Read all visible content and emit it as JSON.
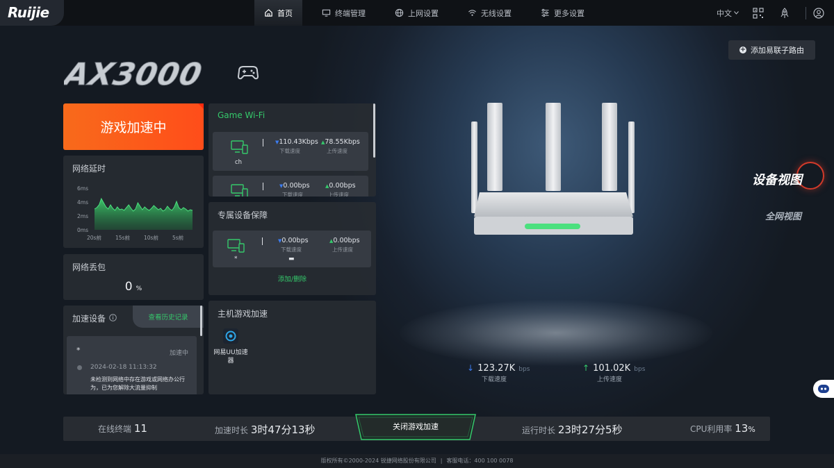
{
  "brand": {
    "logo_text": "Ruijie"
  },
  "nav": {
    "items": [
      {
        "label": "首页",
        "icon": "home-icon"
      },
      {
        "label": "终端管理",
        "icon": "devices-icon"
      },
      {
        "label": "上网设置",
        "icon": "globe-icon"
      },
      {
        "label": "无线设置",
        "icon": "wifi-icon"
      },
      {
        "label": "更多设置",
        "icon": "sliders-icon"
      }
    ],
    "active": "首页"
  },
  "topright": {
    "language": "中文",
    "icons": [
      "qr-code-icon",
      "rocket-icon",
      "user-icon"
    ]
  },
  "add_router": {
    "label": "添加易联子路由"
  },
  "model_logo": {
    "text": "AX3000"
  },
  "accel": {
    "label": "游戏加速中"
  },
  "latency": {
    "title": "网络延时",
    "y_ticks": [
      "6ms",
      "4ms",
      "2ms",
      "0ms"
    ],
    "x_ticks": [
      "20s前",
      "15s前",
      "10s前",
      "5s前"
    ]
  },
  "chart_data": {
    "type": "area",
    "title": "网络延时",
    "ylim": [
      0,
      6
    ],
    "y_ticks": [
      "6ms",
      "4ms",
      "2ms",
      "0ms"
    ],
    "x_ticks": [
      "20s前",
      "15s前",
      "10s前",
      "5s前"
    ],
    "values": [
      3.0,
      3.2,
      3.6,
      4.5,
      3.9,
      3.3,
      3.0,
      3.6,
      3.1,
      2.8,
      3.3,
      2.9,
      3.0,
      2.8,
      3.2,
      3.6,
      3.1,
      2.7,
      3.0,
      3.9,
      3.4,
      2.9,
      3.3,
      3.0,
      2.8,
      3.1,
      3.5,
      3.2,
      2.9,
      3.1,
      2.7,
      2.9,
      3.4,
      3.0,
      2.8,
      3.3,
      4.1,
      3.2,
      2.9,
      3.2,
      3.0,
      2.7,
      2.9,
      2.8
    ]
  },
  "loss": {
    "title": "网络丢包",
    "value": "0",
    "unit": "%"
  },
  "accel_devices": {
    "title": "加速设备",
    "info_icon": "info-icon",
    "history_label": "查看历史记录",
    "item": {
      "name": "*",
      "status": "加速中",
      "time": "2024-02-18 11:13:32",
      "message": "未检测到网络中存在游戏或网络办公行为，已为您解除大流量抑制"
    }
  },
  "game_wifi": {
    "title": "Game Wi-Fi",
    "devices": [
      {
        "name": "ch",
        "down": "110.43Kbps",
        "up": "78.55Kbps",
        "down_label": "下载速度",
        "up_label": "上传速度"
      },
      {
        "name": "",
        "down": "0.00bps",
        "up": "0.00bps",
        "down_label": "下载速度",
        "up_label": "上传速度"
      }
    ]
  },
  "dedicated": {
    "title": "专属设备保障",
    "device": {
      "name": "*",
      "down": "0.00bps",
      "up": "0.00bps",
      "down_label": "下载速度",
      "up_label": "上传速度",
      "value": "▬"
    },
    "add_remove": "添加/删除"
  },
  "console": {
    "title": "主机游戏加速",
    "app_name": "网易UU加速器"
  },
  "router_speed": {
    "down_value": "123.27K",
    "down_unit": "bps",
    "down_label": "下载速度",
    "up_value": "101.02K",
    "up_unit": "bps",
    "up_label": "上传速度"
  },
  "views": {
    "device_view": "设备视图",
    "network_view": "全网视图"
  },
  "stats": {
    "online_label": "在线终端",
    "online_value": "11",
    "accel_time_label": "加速时长",
    "accel_time_value": "3时47分13秒",
    "close_label": "关闭游戏加速",
    "uptime_label": "运行时长",
    "uptime_value": "23时27分5秒",
    "cpu_label": "CPU利用率",
    "cpu_value": "13",
    "cpu_unit": "%"
  },
  "footer": {
    "copyright": "版权所有©2000-2024 锐捷网络股份有限公司",
    "hotline": "客服电话：400 100 0078"
  },
  "colors": {
    "accent_orange": "#f86a1b",
    "accent_green": "#35c96b",
    "download_blue": "#3c7cf0"
  }
}
